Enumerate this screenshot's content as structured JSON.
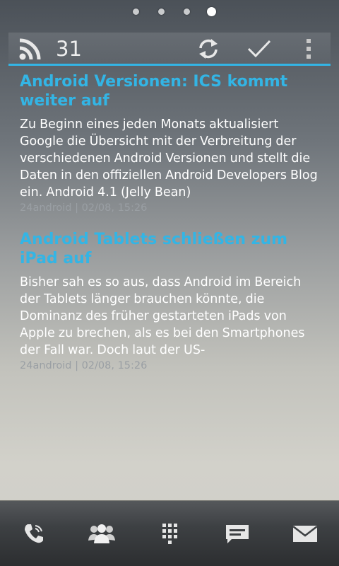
{
  "home": {
    "page_indicator": {
      "count": 4,
      "active": 4
    }
  },
  "widget": {
    "header": {
      "feed_icon": "rss-icon",
      "unread_count": "31",
      "actions": [
        "refresh-icon",
        "mark-read-check-icon",
        "overflow-menu-icon"
      ]
    },
    "accent_color": "#33b5e5",
    "articles": [
      {
        "title": "Android Versionen: ICS kommt weiter auf",
        "body": "Zu Beginn eines jeden Monats aktualisiert Google die Übersicht mit der Verbreitung der verschiedenen Android Versionen und stellt die Daten in den offiziellen Android Developers Blog ein. Android 4.1 (Jelly Bean)",
        "meta": "24android | 02/08, 15:26"
      },
      {
        "title": "Android Tablets schließen zum iPad auf",
        "body": "Bisher sah es so aus, dass Android im Bereich der Tablets länger brauchen könnte, die Dominanz des früher gestarteten iPads von Apple zu brechen, als es bei den Smartphones der Fall war. Doch laut der US-",
        "meta": "24android | 02/08, 15:26"
      }
    ]
  },
  "dock": {
    "items": [
      "phone-icon",
      "contacts-icon",
      "dialpad-icon",
      "messaging-icon",
      "email-icon"
    ]
  }
}
